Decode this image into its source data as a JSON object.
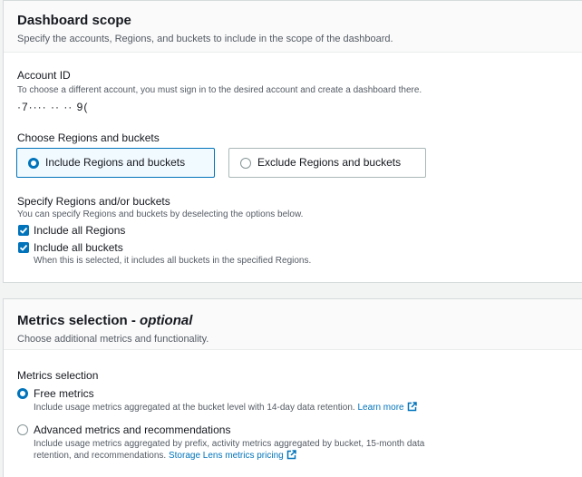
{
  "dashboard_scope": {
    "title": "Dashboard scope",
    "description": "Specify the accounts, Regions, and buckets to include in the scope of the dashboard.",
    "account": {
      "label": "Account ID",
      "description": "To choose a different account, you must sign in to the desired account and create a dashboard there.",
      "value": "·7···· ·· ·· 9("
    },
    "regions": {
      "label": "Choose Regions and buckets",
      "options": [
        {
          "label": "Include Regions and buckets",
          "selected": true
        },
        {
          "label": "Exclude Regions and buckets",
          "selected": false
        }
      ]
    },
    "specify": {
      "label": "Specify Regions and/or buckets",
      "description": "You can specify Regions and buckets by deselecting the options below.",
      "include_regions": {
        "label": "Include all Regions",
        "checked": true
      },
      "include_buckets": {
        "label": "Include all buckets",
        "checked": true,
        "description": "When this is selected, it includes all buckets in the specified Regions."
      }
    }
  },
  "metrics_selection": {
    "title": "Metrics selection - ",
    "title_optional": "optional",
    "description": "Choose additional metrics and functionality.",
    "group_label": "Metrics selection",
    "options": [
      {
        "label": "Free metrics",
        "selected": true,
        "description": "Include usage metrics aggregated at the bucket level with 14-day data retention.",
        "link": "Learn more"
      },
      {
        "label": "Advanced metrics and recommendations",
        "selected": false,
        "description_line1": "Include usage metrics aggregated by prefix, activity metrics aggregated by bucket, 15-month data",
        "description_line2": "retention, and recommendations.",
        "link": "Storage Lens metrics pricing"
      }
    ]
  },
  "colors": {
    "accent": "#0073bb",
    "selected_tile_bg": "#f1faff",
    "page_bg": "#f2f3f3"
  },
  "icons": [
    "radio-selected",
    "radio-unselected",
    "checkbox-checked",
    "external-link-icon"
  ]
}
